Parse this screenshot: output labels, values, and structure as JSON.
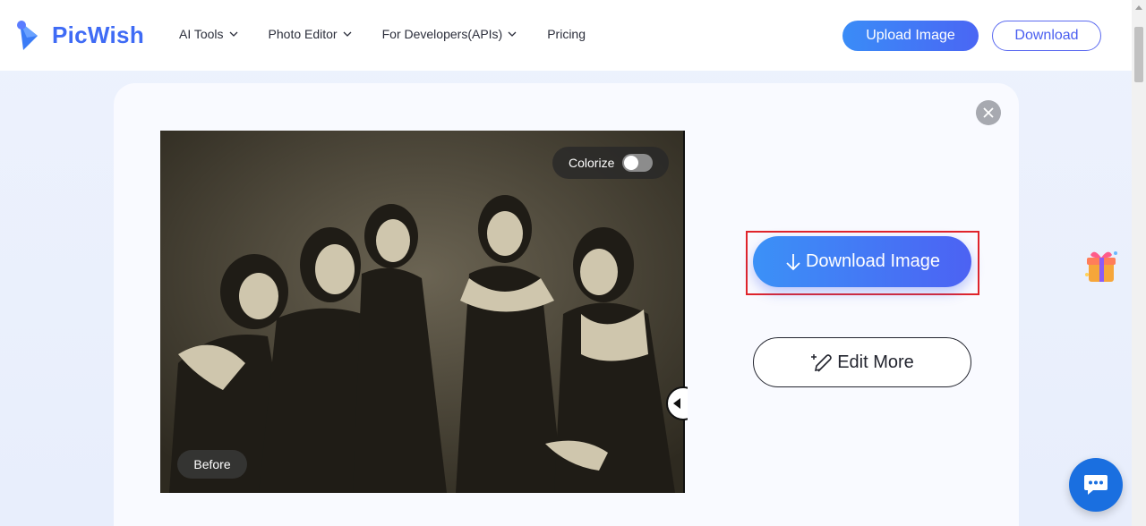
{
  "brand": {
    "name": "PicWish",
    "accent": "#3f6bf5"
  },
  "nav": {
    "items": [
      {
        "label": "AI Tools",
        "has_dropdown": true
      },
      {
        "label": "Photo Editor",
        "has_dropdown": true
      },
      {
        "label": "For Developers(APIs)",
        "has_dropdown": true
      },
      {
        "label": "Pricing",
        "has_dropdown": false
      }
    ]
  },
  "header_actions": {
    "upload_label": "Upload Image",
    "download_label": "Download"
  },
  "editor": {
    "colorize_label": "Colorize",
    "colorize_enabled": false,
    "before_label": "Before",
    "download_image_label": "Download Image",
    "edit_more_label": "Edit More",
    "highlight_color": "#e0242b"
  },
  "icons": {
    "close": "close-icon",
    "download": "arrow-down-icon",
    "edit": "magic-pen-icon",
    "gift": "gift-icon",
    "chat": "chat-icon"
  }
}
